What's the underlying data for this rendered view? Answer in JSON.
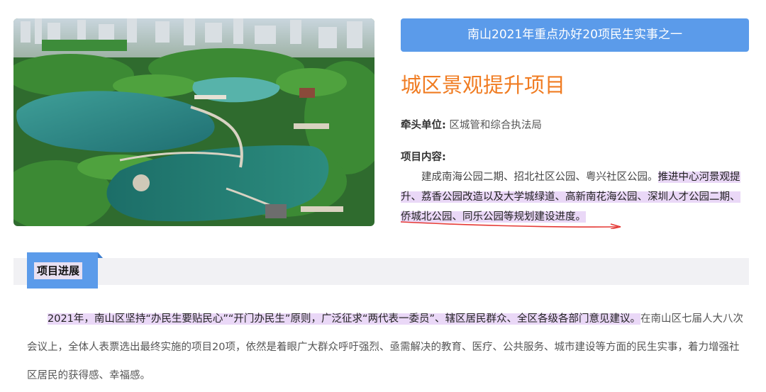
{
  "photo": {
    "alt": ""
  },
  "banner": {
    "text": "南山2021年重点办好20项民生实事之一"
  },
  "headline": {
    "text": "城区景观提升项目"
  },
  "lead_unit": {
    "label": "牵头单位:",
    "value": "区城管和综合执法局"
  },
  "content": {
    "label": "项目内容:",
    "plain": "建成南海公园二期、招北社区公园、粤兴社区公园。",
    "highlighted": "推进中心河景观提升、荔香公园改造以及大学城绿道、高新南花海公园、深圳人才公园二期、侨城北公园、同乐公园等规划建设进度。"
  },
  "section": {
    "title": "项目进展"
  },
  "progress": {
    "highlighted": "2021年，南山区坚持“办民生要贴民心”“开门办民生”原则，广泛征求“两代表一委员”、辖区居民群众、全区各级各部门意见建议。",
    "plain": "在南山区七届人大八次会议上，全体人表票选出最终实施的项目20项，依然是着眼广大群众呼吁强烈、亟需解决的教育、医疗、公共服务、城市建设等方面的民生实事，着力增强社区居民的获得感、幸福感。"
  },
  "colors": {
    "banner": "#5b9bea",
    "headline": "#f07c22",
    "highlight": "#ead8f7",
    "underline": "#e53935"
  }
}
